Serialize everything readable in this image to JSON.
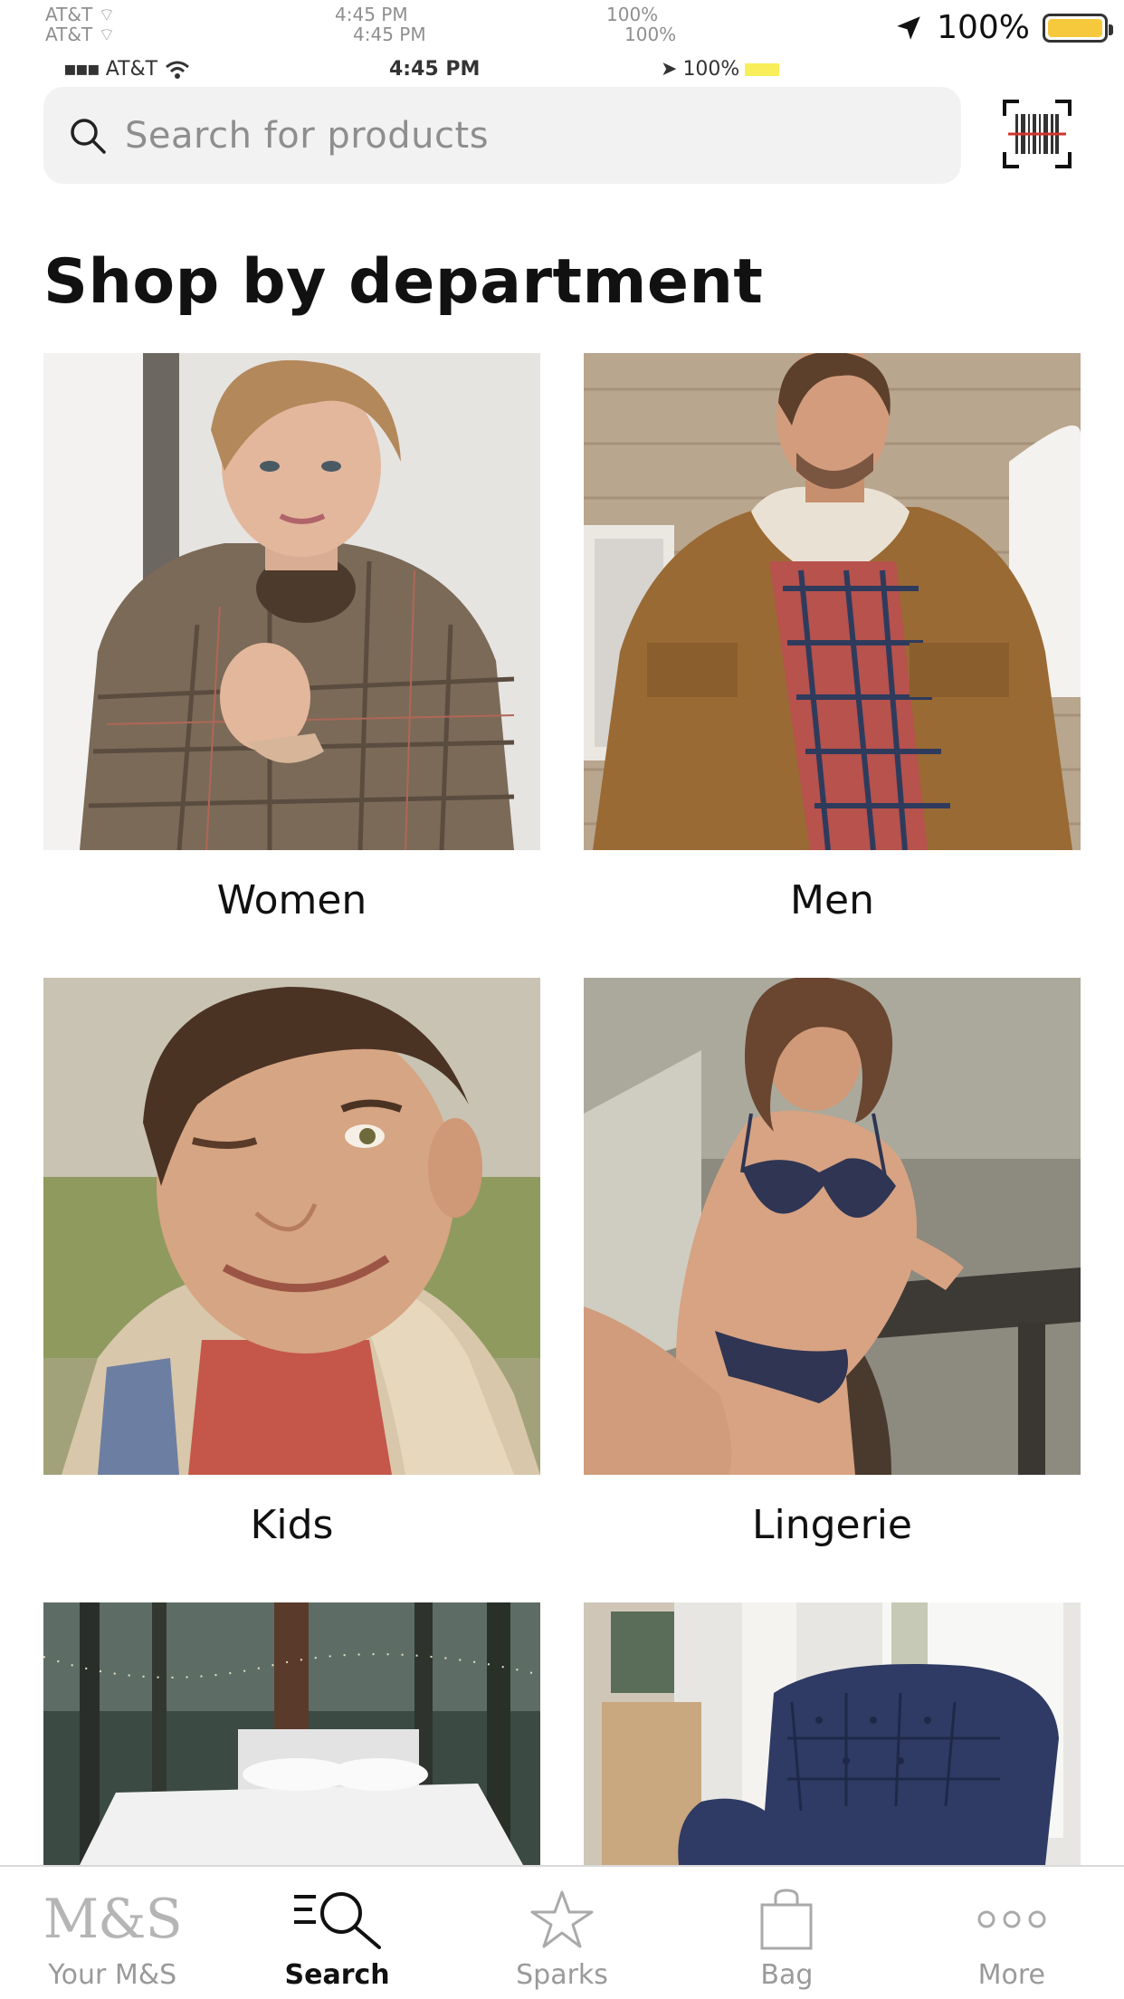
{
  "status_bar": {
    "carrier": "AT&T",
    "time": "4:45 PM",
    "battery_percent": "100%",
    "battery_level": 1.0,
    "battery_color": "#f5c93b"
  },
  "search": {
    "placeholder": "Search for products",
    "value": ""
  },
  "barcode_button": {
    "icon": "barcode-scanner-icon"
  },
  "main": {
    "title": "Shop by department",
    "departments": [
      {
        "label": "Women",
        "image": "woman-in-check-coat-photo"
      },
      {
        "label": "Men",
        "image": "man-in-cord-jacket-photo"
      },
      {
        "label": "Kids",
        "image": "boy-winking-photo"
      },
      {
        "label": "Lingerie",
        "image": "woman-in-lingerie-photo"
      },
      {
        "label": "",
        "image": "bedroom-in-forest-photo"
      },
      {
        "label": "",
        "image": "blue-velvet-armchair-photo"
      }
    ]
  },
  "tabbar": {
    "logo_text": "M&S",
    "tabs": [
      {
        "label": "Your M&S",
        "icon": "ms-logo-icon",
        "active": false
      },
      {
        "label": "Search",
        "icon": "search-list-icon",
        "active": true
      },
      {
        "label": "Sparks",
        "icon": "star-icon",
        "active": false
      },
      {
        "label": "Bag",
        "icon": "bag-icon",
        "active": false
      },
      {
        "label": "More",
        "icon": "more-dots-icon",
        "active": false
      }
    ]
  },
  "colors": {
    "search_bg": "#f2f2f2",
    "placeholder": "#8e8e8e",
    "inactive_tab": "#9a9a9a",
    "active_tab": "#111111"
  }
}
